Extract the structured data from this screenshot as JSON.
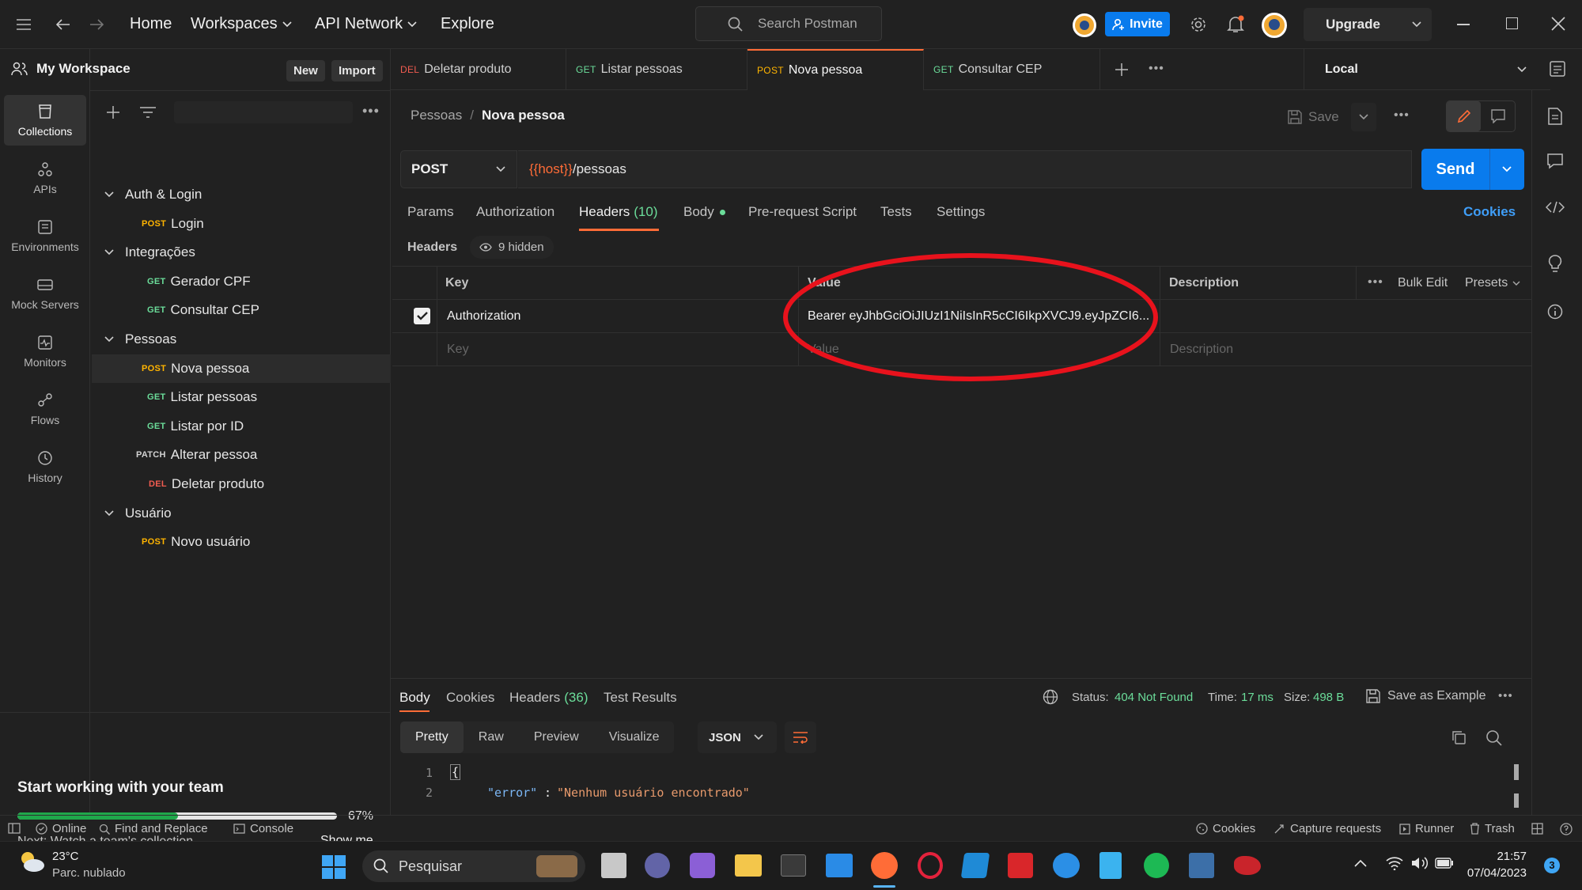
{
  "topbar": {
    "nav": {
      "home": "Home",
      "workspaces": "Workspaces",
      "api_network": "API Network",
      "explore": "Explore"
    },
    "search_placeholder": "Search Postman",
    "invite": "Invite",
    "upgrade": "Upgrade"
  },
  "workspace": {
    "name": "My Workspace",
    "new": "New",
    "import": "Import"
  },
  "rail": [
    {
      "label": "Collections",
      "icon": "collections-icon"
    },
    {
      "label": "APIs",
      "icon": "apis-icon"
    },
    {
      "label": "Environments",
      "icon": "environments-icon"
    },
    {
      "label": "Mock Servers",
      "icon": "mock-servers-icon"
    },
    {
      "label": "Monitors",
      "icon": "monitors-icon"
    },
    {
      "label": "Flows",
      "icon": "flows-icon"
    },
    {
      "label": "History",
      "icon": "history-icon"
    }
  ],
  "tree": [
    {
      "type": "folder",
      "label": "Auth & Login"
    },
    {
      "type": "request",
      "method": "POST",
      "label": "Login"
    },
    {
      "type": "folder",
      "label": "Integrações"
    },
    {
      "type": "request",
      "method": "GET",
      "label": "Gerador CPF"
    },
    {
      "type": "request",
      "method": "GET",
      "label": "Consultar CEP"
    },
    {
      "type": "folder",
      "label": "Pessoas"
    },
    {
      "type": "request",
      "method": "POST",
      "label": "Nova pessoa"
    },
    {
      "type": "request",
      "method": "GET",
      "label": "Listar pessoas"
    },
    {
      "type": "request",
      "method": "GET",
      "label": "Listar por ID"
    },
    {
      "type": "request",
      "method": "PATCH",
      "label": "Alterar pessoa"
    },
    {
      "type": "request",
      "method": "DEL",
      "label": "Deletar produto"
    },
    {
      "type": "folder",
      "label": "Usuário"
    },
    {
      "type": "request",
      "method": "POST",
      "label": "Novo usuário"
    }
  ],
  "team": {
    "title": "Start working with your team",
    "progress": 0.67,
    "progress_label": "67%",
    "next": "Next: Watch a team's collection.",
    "show_me": "Show me"
  },
  "tabs": [
    {
      "method": "DEL",
      "label": "Deletar produto"
    },
    {
      "method": "GET",
      "label": "Listar pessoas"
    },
    {
      "method": "POST",
      "label": "Nova pessoa"
    },
    {
      "method": "GET",
      "label": "Consultar CEP"
    }
  ],
  "environment": "Local",
  "breadcrumb": {
    "parent": "Pessoas",
    "sep": "/",
    "current": "Nova pessoa"
  },
  "save": "Save",
  "request": {
    "method": "POST",
    "url_var": "{{host}}",
    "url_path": "/pessoas",
    "send": "Send"
  },
  "subtabs": {
    "params": "Params",
    "authorization": "Authorization",
    "headers": "Headers",
    "headers_count": "(10)",
    "body": "Body",
    "prerequest": "Pre-request Script",
    "tests": "Tests",
    "settings": "Settings",
    "cookies": "Cookies"
  },
  "headers_bar": {
    "label": "Headers",
    "hidden": "9 hidden"
  },
  "headers_table": {
    "columns": {
      "key": "Key",
      "value": "Value",
      "description": "Description"
    },
    "bulk_edit": "Bulk Edit",
    "presets": "Presets",
    "rows": [
      {
        "key": "Authorization",
        "value": "Bearer eyJhbGciOiJIUzI1NiIsInR5cCI6IkpXVCJ9.eyJpZCI6...",
        "checked": true
      }
    ],
    "placeholder": {
      "key": "Key",
      "value": "Value",
      "description": "Description"
    }
  },
  "response": {
    "tabs": {
      "body": "Body",
      "cookies": "Cookies",
      "headers": "Headers",
      "headers_count": "(36)",
      "test_results": "Test Results"
    },
    "status_label": "Status:",
    "status_value": "404 Not Found",
    "time_label": "Time:",
    "time_value": "17 ms",
    "size_label": "Size:",
    "size_value": "498 B",
    "save_example": "Save as Example",
    "views": {
      "pretty": "Pretty",
      "raw": "Raw",
      "preview": "Preview",
      "visualize": "Visualize"
    },
    "format": "JSON",
    "lines": [
      {
        "no": "1",
        "text": "{"
      },
      {
        "no": "2",
        "key": "\"error\"",
        "colon": ": ",
        "value": "\"Nenhum usuário encontrado\""
      }
    ]
  },
  "statusbar": {
    "online": "Online",
    "find_replace": "Find and Replace",
    "console": "Console",
    "cookies": "Cookies",
    "capture": "Capture requests",
    "runner": "Runner",
    "trash": "Trash"
  },
  "taskbar": {
    "weather_temp": "23°C",
    "weather_desc": "Parc. nublado",
    "search": "Pesquisar",
    "time": "21:57",
    "date": "07/04/2023",
    "notif_count": "3"
  },
  "colors": {
    "accent": "#ff6c37",
    "send": "#097bed",
    "post": "#ffb400",
    "get": "#6bdd9a",
    "del": "#f05c50",
    "annotation": "#e8121c",
    "success": "#6bdd9a"
  }
}
